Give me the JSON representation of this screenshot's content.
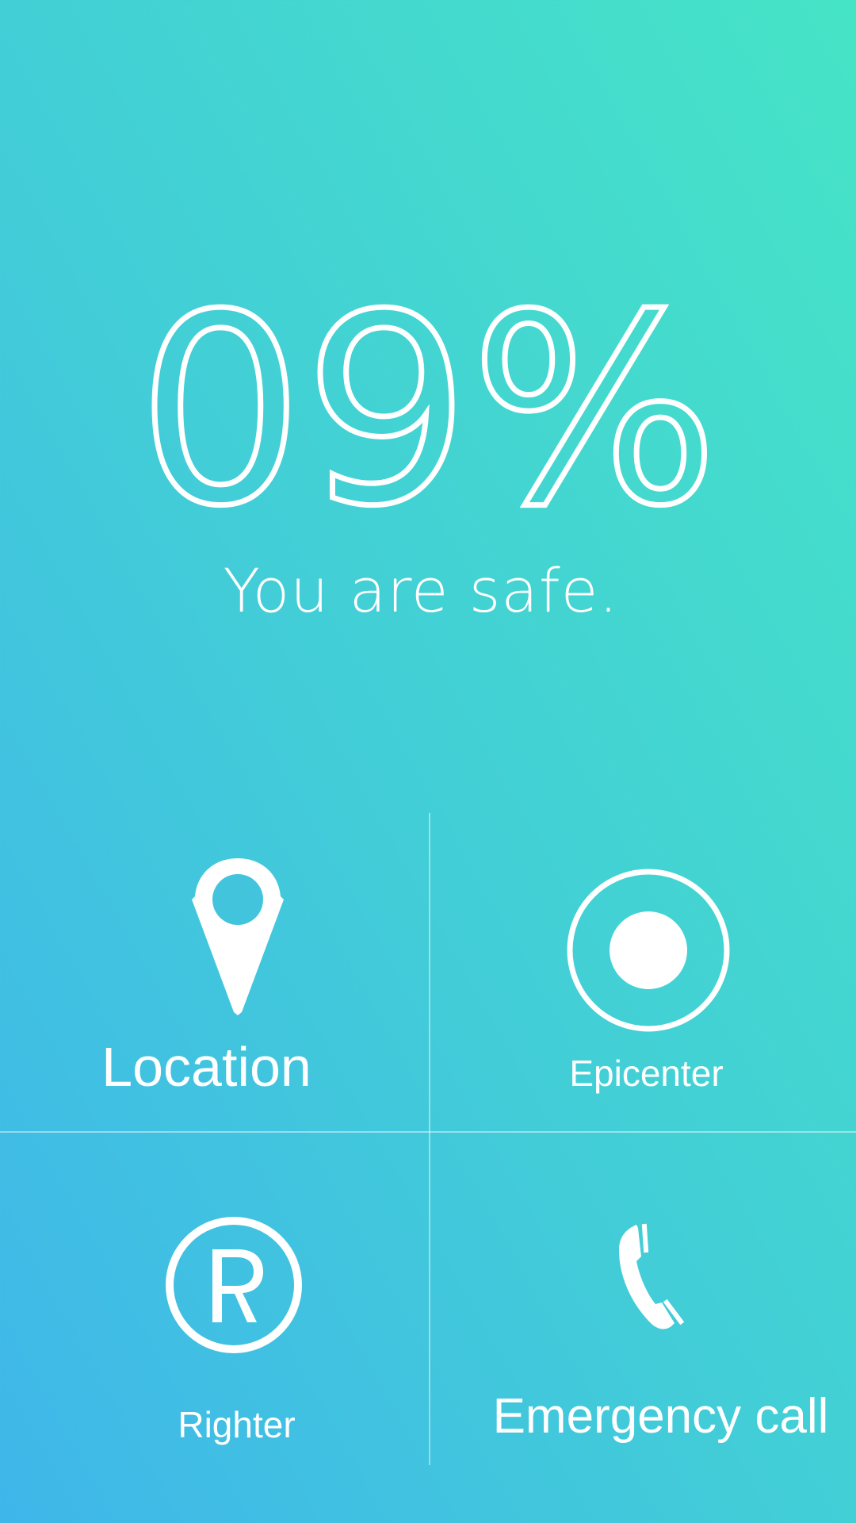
{
  "dashboard": {
    "risk_percent_text": "09%",
    "status_message": "You are safe."
  },
  "tiles": [
    {
      "label": "Location",
      "icon": "location-pin-icon"
    },
    {
      "label": "Epicenter",
      "icon": "target-icon"
    },
    {
      "label": "Righter",
      "icon": "registered-r-icon"
    },
    {
      "label": "Emergency call",
      "icon": "phone-icon"
    }
  ],
  "colors": {
    "gradient_start": "#3fb6ea",
    "gradient_end": "#46e4c6",
    "foreground": "#ffffff"
  }
}
